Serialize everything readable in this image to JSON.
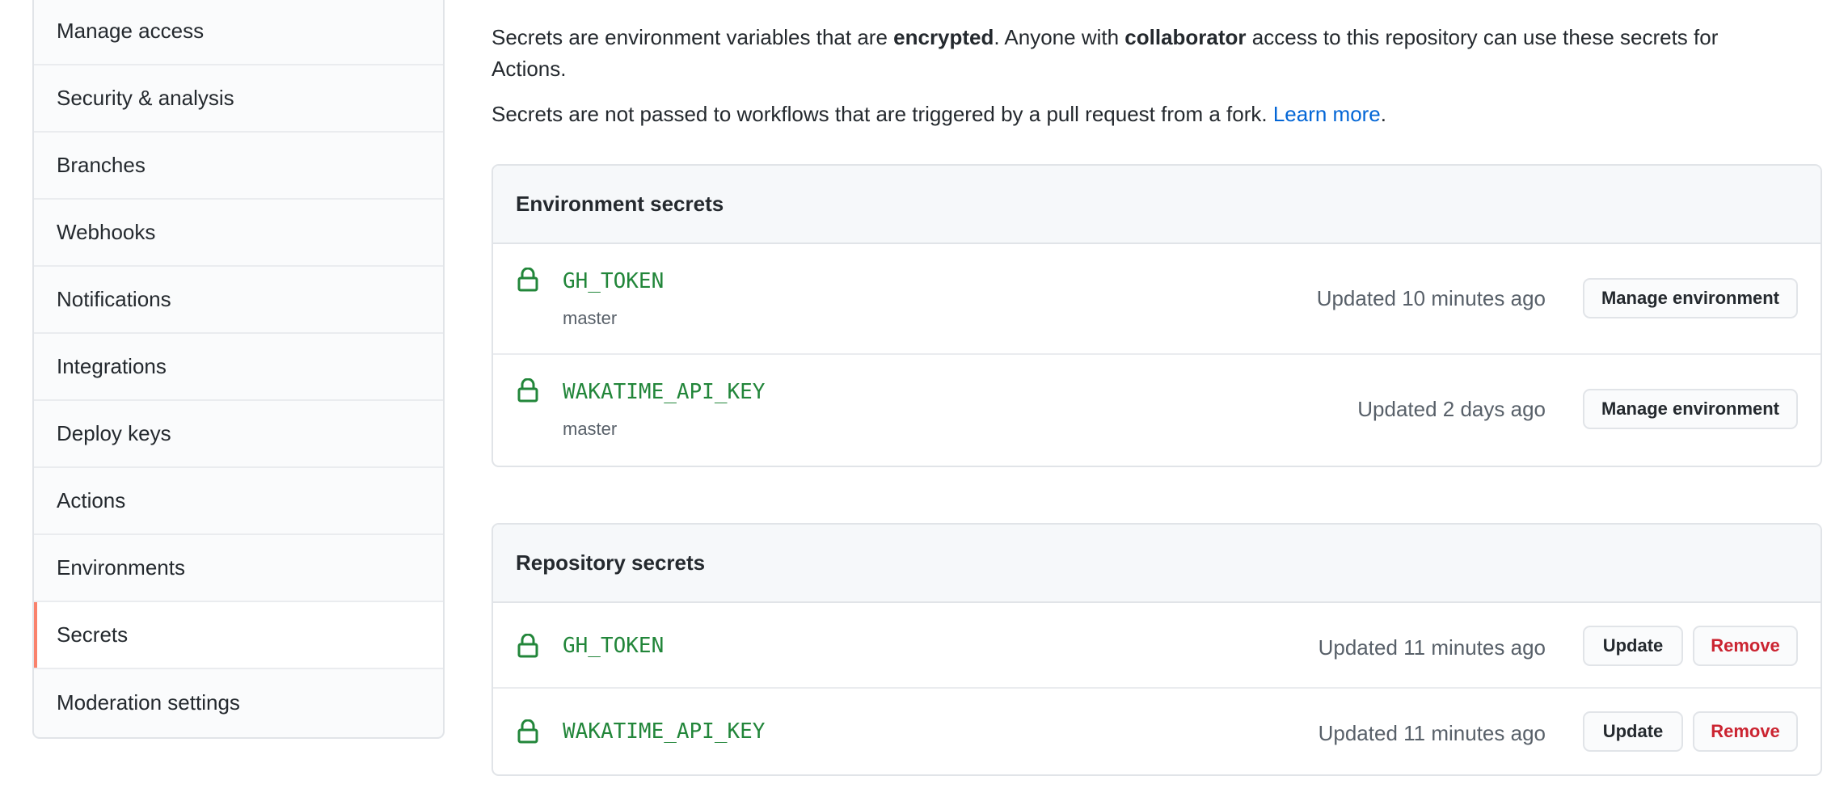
{
  "sidebar": {
    "items": [
      {
        "label": "Manage access"
      },
      {
        "label": "Security & analysis"
      },
      {
        "label": "Branches"
      },
      {
        "label": "Webhooks"
      },
      {
        "label": "Notifications"
      },
      {
        "label": "Integrations"
      },
      {
        "label": "Deploy keys"
      },
      {
        "label": "Actions"
      },
      {
        "label": "Environments"
      },
      {
        "label": "Secrets",
        "selected": true
      },
      {
        "label": "Moderation settings"
      }
    ]
  },
  "intro": {
    "p1_a": "Secrets are environment variables that are ",
    "p1_b": "encrypted",
    "p1_c": ". Anyone with ",
    "p1_d": "collaborator",
    "p1_e": " access to this repository can use these secrets for Actions.",
    "p2_a": "Secrets are not passed to workflows that are triggered by a pull request from a fork. ",
    "p2_link": "Learn more",
    "p2_end": "."
  },
  "environment_secrets": {
    "title": "Environment secrets",
    "rows": [
      {
        "name": "GH_TOKEN",
        "environment": "master",
        "updated": "Updated 10 minutes ago",
        "button": "Manage environment"
      },
      {
        "name": "WAKATIME_API_KEY",
        "environment": "master",
        "updated": "Updated 2 days ago",
        "button": "Manage environment"
      }
    ]
  },
  "repository_secrets": {
    "title": "Repository secrets",
    "rows": [
      {
        "name": "GH_TOKEN",
        "updated": "Updated 11 minutes ago",
        "update_label": "Update",
        "remove_label": "Remove"
      },
      {
        "name": "WAKATIME_API_KEY",
        "updated": "Updated 11 minutes ago",
        "update_label": "Update",
        "remove_label": "Remove"
      }
    ]
  },
  "colors": {
    "accent_selected": "#f9826c",
    "secret_name": "#22863a",
    "link": "#0366d6",
    "danger": "#cb2431"
  },
  "icons": {
    "secret": "lock-icon"
  }
}
